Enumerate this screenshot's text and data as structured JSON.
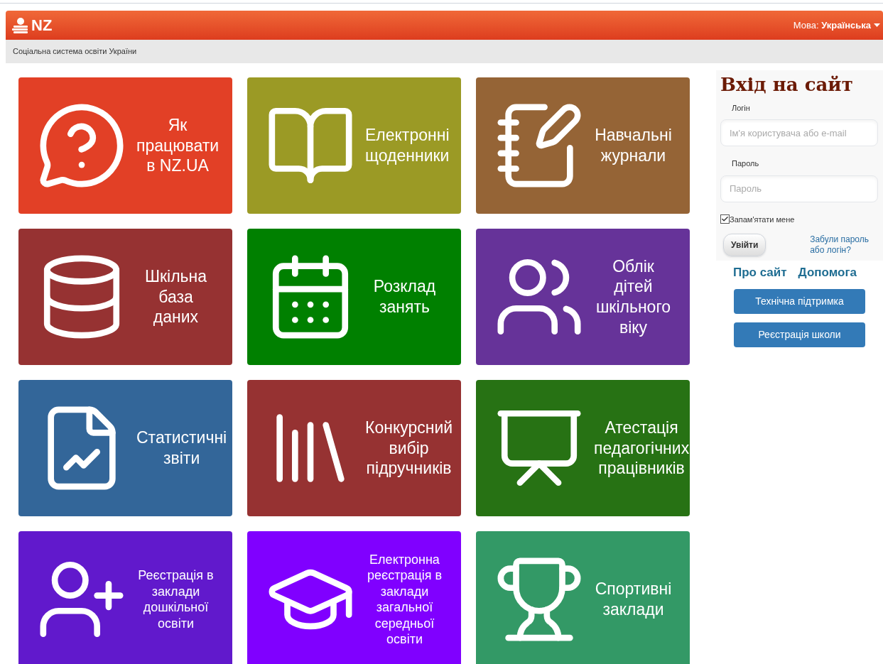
{
  "header": {
    "logo": "NZ",
    "language_label": "Мова:",
    "language": "Українська",
    "tagline": "Соціальна система освіти України"
  },
  "tiles": [
    {
      "kind": "help",
      "title": "Як\nпрацювати\nв NZ.UA",
      "color": "#e24026"
    },
    {
      "kind": "book",
      "title": "Електронні\nщоденники",
      "color": "#9b9a25"
    },
    {
      "kind": "journal",
      "title": "Навчальні\nжурнали",
      "color": "#956436"
    },
    {
      "kind": "database",
      "title": "Шкільна\nбаза даних",
      "color": "#963232"
    },
    {
      "kind": "calendar",
      "title": "Розклад\nзанять",
      "color": "#008000"
    },
    {
      "kind": "people",
      "title": "Облік дітей\nшкільного\nвіку",
      "color": "#663399"
    },
    {
      "kind": "report",
      "title": "Статистичні\nзвіти",
      "color": "#336699"
    },
    {
      "kind": "library",
      "title": "Конкурсний\nвибір\nпідручників",
      "color": "#963232"
    },
    {
      "kind": "presentation",
      "title": "Атестація\nпедагогічних\nпрацівників",
      "color": "#277214"
    },
    {
      "kind": "adduser",
      "title": "Реєстрація в\nзаклади\nдошкільної\nосвіти",
      "color": "#6119cc"
    },
    {
      "kind": "graduate",
      "title": "Електронна\nреєстрація в\nзаклади\nзагальної\nсередньої освіти",
      "color": "#8000ff"
    },
    {
      "kind": "sport",
      "title": "Спортивні\nзаклади",
      "color": "#339966"
    }
  ],
  "login": {
    "title": "Вхід на сайт",
    "login_label": "Логін",
    "login_placeholder": "Ім'я користувача або e-mail",
    "password_label": "Пароль",
    "password_placeholder": "Пароль",
    "remember": {
      "label": "Запам'ятати мене",
      "checked": true
    },
    "submit": "Увійти",
    "forgot": "Забули пароль\nабо логін?"
  },
  "links": [
    "Про сайт",
    "Допомога"
  ],
  "buttons": [
    "Технічна підтримка",
    "Реєстрація школи"
  ]
}
